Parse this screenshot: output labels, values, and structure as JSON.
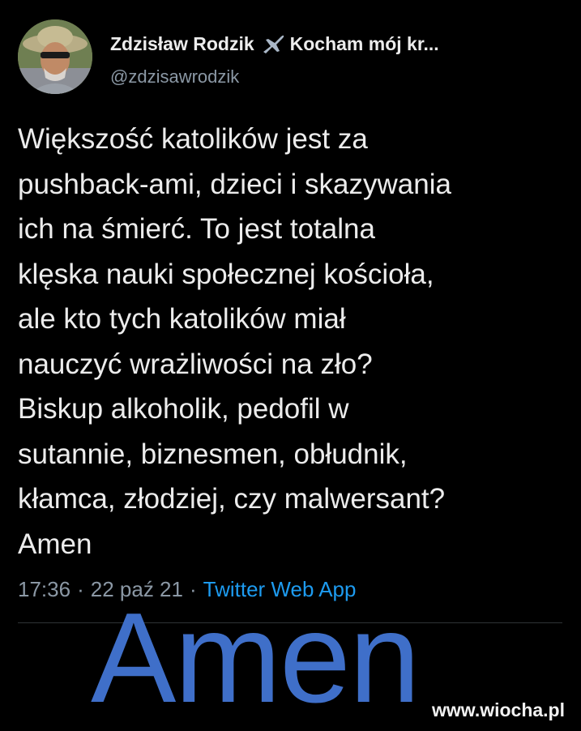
{
  "author": {
    "display_name": "Zdzisław Rodzik",
    "name_suffix": "Kocham mój kr...",
    "handle": "@zdzisawrodzik",
    "emoji_icon": "airplane-icon"
  },
  "tweet": {
    "lines": [
      "Większość katolików jest za",
      "pushback-ami, dzieci i skazywania",
      "ich na śmierć. To jest totalna",
      "klęska nauki społecznej kościoła,",
      "ale kto tych katolików miał",
      "nauczyć wrażliwości na zło?",
      "Biskup alkoholik, pedofil w",
      "sutannie, biznesmen, obłudnik,",
      "kłamca, złodziej, czy malwersant?",
      "Amen"
    ],
    "time": "17:36",
    "separator": "·",
    "date": "22 paź 21",
    "source": "Twitter Web App"
  },
  "overlay": {
    "text": "Amen",
    "color": "#3f6fc9"
  },
  "watermark": {
    "text": "www.wiocha.pl"
  },
  "colors": {
    "background": "#000000",
    "text": "#ececec",
    "secondary": "#8b98a5",
    "link": "#1d9bf0"
  }
}
